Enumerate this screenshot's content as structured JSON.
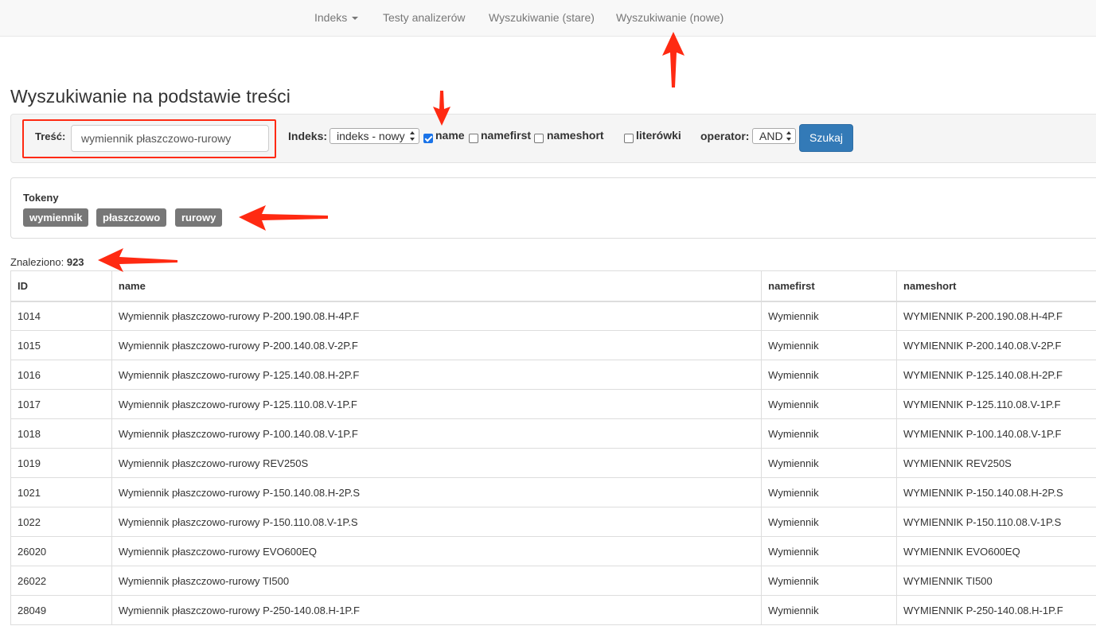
{
  "nav": {
    "items": [
      {
        "label": "Indeks",
        "dropdown": true
      },
      {
        "label": "Testy analizerów"
      },
      {
        "label": "Wyszukiwanie (stare)"
      },
      {
        "label": "Wyszukiwanie (nowe)"
      }
    ]
  },
  "page_title": "Wyszukiwanie na podstawie treści",
  "form": {
    "content_label": "Treść:",
    "content_value": "wymiennik płaszczowo-rurowy",
    "index_label": "Indeks:",
    "index_selected": "indeks - nowy",
    "checkboxes": [
      {
        "label": "name",
        "checked": true
      },
      {
        "label": "namefirst",
        "checked": false
      },
      {
        "label": "nameshort",
        "checked": false
      },
      {
        "label": "literówki",
        "checked": false
      }
    ],
    "operator_label": "operator:",
    "operator_selected": "AND",
    "search_button": "Szukaj"
  },
  "tokens": {
    "title": "Tokeny",
    "items": [
      "wymiennik",
      "płaszczowo",
      "rurowy"
    ]
  },
  "results": {
    "found_label": "Znaleziono:",
    "found_count": "923",
    "columns": [
      "ID",
      "name",
      "namefirst",
      "nameshort"
    ],
    "rows": [
      [
        "1014",
        "Wymiennik płaszczowo-rurowy P-200.190.08.H-4P.F",
        "Wymiennik",
        "WYMIENNIK P-200.190.08.H-4P.F"
      ],
      [
        "1015",
        "Wymiennik płaszczowo-rurowy P-200.140.08.V-2P.F",
        "Wymiennik",
        "WYMIENNIK P-200.140.08.V-2P.F"
      ],
      [
        "1016",
        "Wymiennik płaszczowo-rurowy P-125.140.08.H-2P.F",
        "Wymiennik",
        "WYMIENNIK P-125.140.08.H-2P.F"
      ],
      [
        "1017",
        "Wymiennik płaszczowo-rurowy P-125.110.08.V-1P.F",
        "Wymiennik",
        "WYMIENNIK P-125.110.08.V-1P.F"
      ],
      [
        "1018",
        "Wymiennik płaszczowo-rurowy P-100.140.08.V-1P.F",
        "Wymiennik",
        "WYMIENNIK P-100.140.08.V-1P.F"
      ],
      [
        "1019",
        "Wymiennik płaszczowo-rurowy REV250S",
        "Wymiennik",
        "WYMIENNIK REV250S"
      ],
      [
        "1021",
        "Wymiennik płaszczowo-rurowy P-150.140.08.H-2P.S",
        "Wymiennik",
        "WYMIENNIK P-150.140.08.H-2P.S"
      ],
      [
        "1022",
        "Wymiennik płaszczowo-rurowy P-150.110.08.V-1P.S",
        "Wymiennik",
        "WYMIENNIK P-150.110.08.V-1P.S"
      ],
      [
        "26020",
        "Wymiennik płaszczowo-rurowy EVO600EQ",
        "Wymiennik",
        "WYMIENNIK EVO600EQ"
      ],
      [
        "26022",
        "Wymiennik płaszczowo-rurowy TI500",
        "Wymiennik",
        "WYMIENNIK TI500"
      ],
      [
        "28049",
        "Wymiennik płaszczowo-rurowy P-250-140.08.H-1P.F",
        "Wymiennik",
        "WYMIENNIK P-250-140.08.H-1P.F"
      ]
    ]
  },
  "colors": {
    "annotation": "#ff2a12",
    "primary": "#337ab7",
    "token_bg": "#777777"
  }
}
